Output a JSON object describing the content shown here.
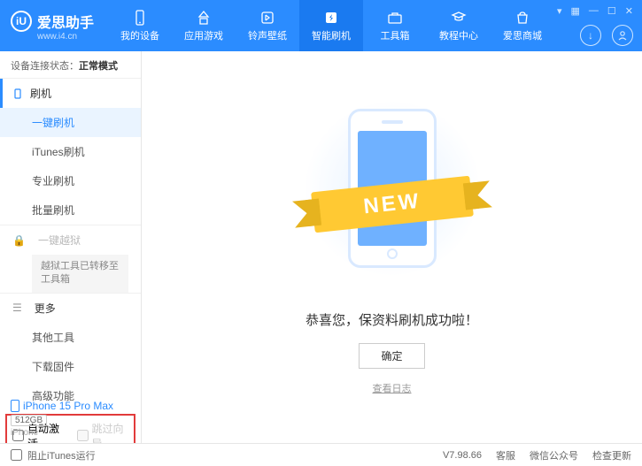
{
  "header": {
    "logo": {
      "title": "爱思助手",
      "url": "www.i4.cn",
      "badge": "iU"
    },
    "nav": [
      {
        "label": "我的设备"
      },
      {
        "label": "应用游戏"
      },
      {
        "label": "铃声壁纸"
      },
      {
        "label": "智能刷机"
      },
      {
        "label": "工具箱"
      },
      {
        "label": "教程中心"
      },
      {
        "label": "爱思商城"
      }
    ]
  },
  "sidebar": {
    "status_label": "设备连接状态：",
    "status_value": "正常模式",
    "group_flash": "刷机",
    "items_flash": [
      {
        "label": "一键刷机"
      },
      {
        "label": "iTunes刷机"
      },
      {
        "label": "专业刷机"
      },
      {
        "label": "批量刷机"
      }
    ],
    "group_jailbreak": "一键越狱",
    "jailbreak_notice": "越狱工具已转移至工具箱",
    "group_more": "更多",
    "items_more": [
      {
        "label": "其他工具"
      },
      {
        "label": "下载固件"
      },
      {
        "label": "高级功能"
      }
    ],
    "checkbox1": "自动激活",
    "checkbox2": "跳过向导",
    "device": {
      "name": "iPhone 15 Pro Max",
      "storage": "512GB",
      "type": "iPhone"
    }
  },
  "main": {
    "ribbon": "NEW",
    "success": "恭喜您，保资料刷机成功啦！",
    "ok": "确定",
    "log_link": "查看日志"
  },
  "footer": {
    "block_itunes": "阻止iTunes运行",
    "version": "V7.98.66",
    "links": [
      "客服",
      "微信公众号",
      "检查更新"
    ]
  }
}
